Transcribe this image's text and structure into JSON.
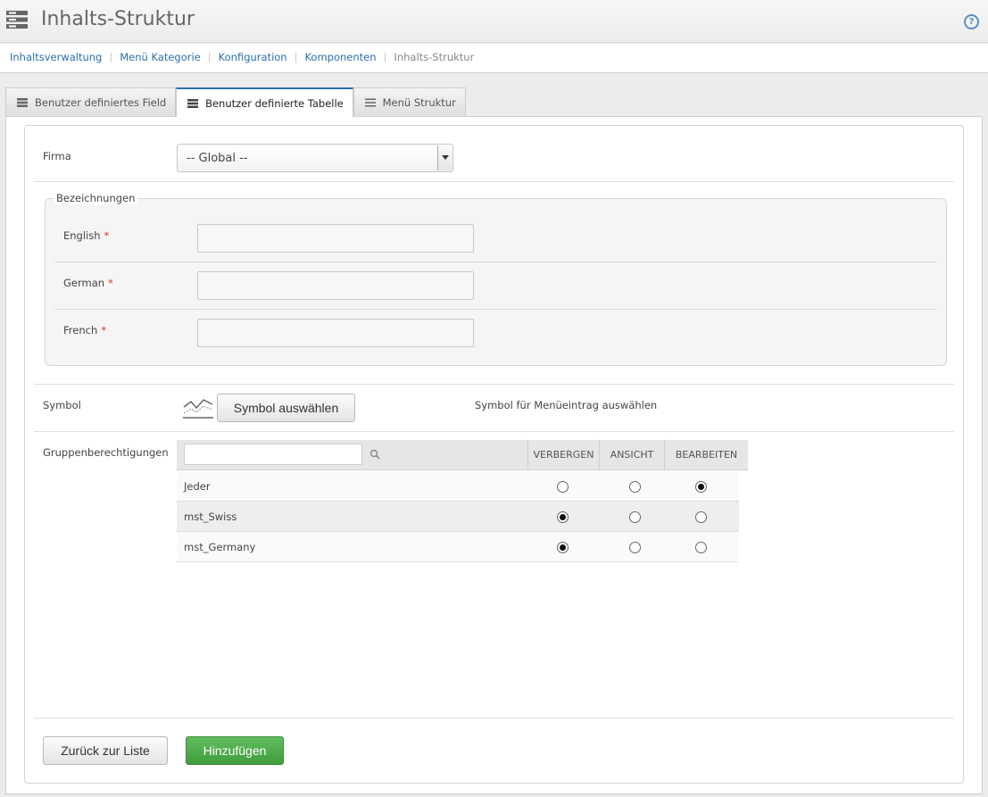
{
  "header": {
    "title": "Inhalts-Struktur",
    "help_label": "?"
  },
  "breadcrumb": {
    "items": [
      "Inhaltsverwaltung",
      "Menü Kategorie",
      "Konfiguration",
      "Komponenten"
    ],
    "current": "Inhalts-Struktur",
    "separator": "|"
  },
  "tabs": [
    {
      "label": "Benutzer definiertes Field",
      "active": false
    },
    {
      "label": "Benutzer definierte Tabelle",
      "active": true
    },
    {
      "label": "Menü Struktur",
      "active": false
    }
  ],
  "form": {
    "firma": {
      "label": "Firma",
      "selected": "-- Global --"
    },
    "bezeichnungen": {
      "legend": "Bezeichnungen",
      "required_mark": "*",
      "fields": [
        {
          "label": "English",
          "value": ""
        },
        {
          "label": "German",
          "value": ""
        },
        {
          "label": "French",
          "value": ""
        }
      ]
    },
    "symbol": {
      "label": "Symbol",
      "button_label": "Symbol auswählen",
      "hint": "Symbol für Menüeintrag auswählen",
      "icon": "line-chart-icon"
    },
    "permissions": {
      "label": "Gruppenberechtigungen",
      "search_placeholder": "",
      "columns": [
        "VERBERGEN",
        "ANSICHT",
        "BEARBEITEN"
      ],
      "rows": [
        {
          "name": "Jeder",
          "selected": "BEARBEITEN"
        },
        {
          "name": "mst_Swiss",
          "selected": "VERBERGEN"
        },
        {
          "name": "mst_Germany",
          "selected": "VERBERGEN"
        }
      ]
    }
  },
  "footer": {
    "back_label": "Zurück zur Liste",
    "add_label": "Hinzufügen"
  },
  "colors": {
    "accent": "#2a6fad",
    "primary_button": "#4cae48",
    "required": "#dd3333"
  }
}
